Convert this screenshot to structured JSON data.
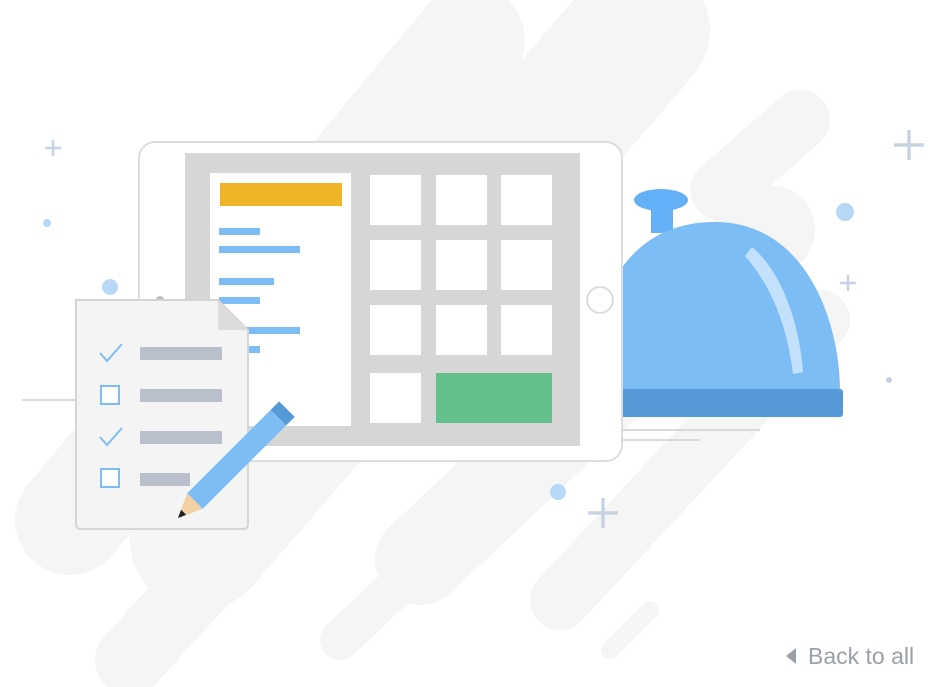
{
  "back_link": {
    "label": "Back to all",
    "icon": "caret-left-icon"
  },
  "colors": {
    "accent_blue": "#7cbdf5",
    "cloche_blue": "#64b0f6",
    "orange_bar": "#f0b429",
    "green_button": "#64c08a",
    "panel_grey": "#d6d6d6",
    "checklist_line": "#b9c0cc"
  }
}
